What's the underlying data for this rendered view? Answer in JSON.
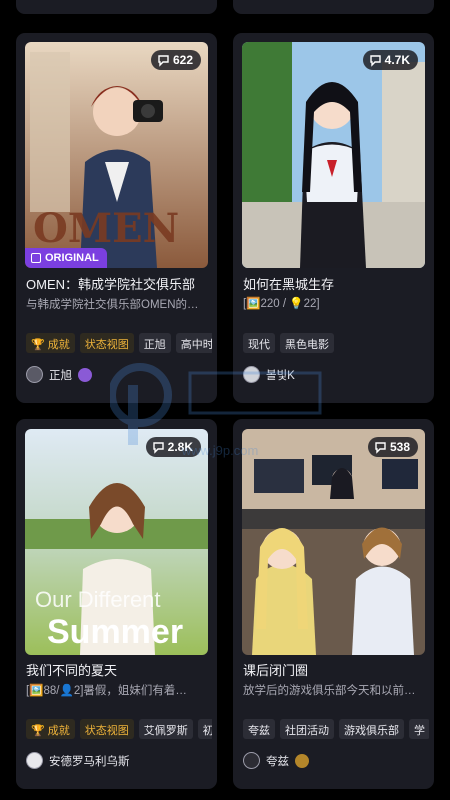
{
  "cards": [
    {
      "views": "622",
      "badge_label": "ORIGINAL",
      "title": "OMEN：韩成学院社交俱乐部",
      "desc": "与韩成学院社交俱乐部OMEN的…",
      "tags": [
        "成就",
        "状态视图",
        "正旭",
        "高中时"
      ],
      "author": "正旭"
    },
    {
      "views": "4.7K",
      "title": "如何在黑城生存",
      "desc": "[🖼️220 / 💡22]",
      "tags": [
        "现代",
        "黑色电影"
      ],
      "author": "볼빛K"
    },
    {
      "views": "2.8K",
      "title": "我们不同的夏天",
      "desc": "[🖼️88/👤2]暑假，姐妹们有着…",
      "tags": [
        "成就",
        "状态视图",
        "艾佩罗斯",
        "初"
      ],
      "author": "安德罗马利乌斯",
      "art_text_1": "Our Different",
      "art_text_2": "Summer"
    },
    {
      "views": "538",
      "title": "课后闭门圈",
      "desc": "放学后的游戏俱乐部今天和以前…",
      "tags": [
        "夸兹",
        "社团活动",
        "游戏俱乐部",
        "学"
      ],
      "author": "夸兹"
    }
  ],
  "card1_art_text": "OMEN",
  "watermark": "www.j9p.com",
  "colors": {
    "card_bg": "#1b1c24",
    "gold_tag": "#f0b43a",
    "original_badge": "#7b3fe0"
  }
}
